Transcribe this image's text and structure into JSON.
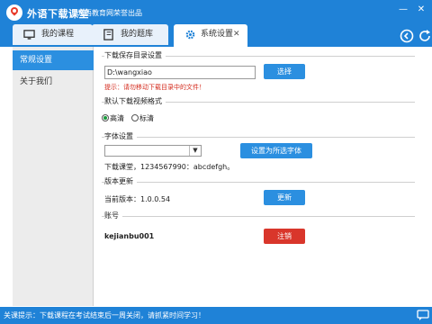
{
  "app": {
    "title": "外语下载课堂",
    "subtitle": "外语教育网荣誉出品",
    "minimize_glyph": "—",
    "close_glyph": "✕"
  },
  "tabs": [
    {
      "label": "我的课程",
      "icon": "monitor-icon"
    },
    {
      "label": "我的题库",
      "icon": "book-icon"
    },
    {
      "label": "系统设置",
      "icon": "gear-icon",
      "close_glyph": "✕",
      "active": true
    }
  ],
  "sidebar": {
    "items": [
      {
        "label": "常规设置",
        "selected": true
      },
      {
        "label": "关于我们",
        "selected": false
      }
    ]
  },
  "settings": {
    "download_path": {
      "title": "下载保存目录设置",
      "value": "D:\\wangxiao",
      "button": "选择",
      "hint": "提示：请勿移动下载目录中的文件！"
    },
    "video_format": {
      "title": "默认下载视频格式",
      "options": [
        {
          "label": "高清",
          "checked": true
        },
        {
          "label": "标清",
          "checked": false
        }
      ]
    },
    "font": {
      "title": "字体设置",
      "selected": "",
      "button": "设置为所选字体",
      "preview": "下载课堂，1234567990：abcdefgh。"
    },
    "version": {
      "title": "版本更新",
      "text": "当前版本：1.0.0.54",
      "button": "更新"
    },
    "account": {
      "title": "账号",
      "username": "kejianbu001",
      "button": "注销"
    }
  },
  "status": {
    "text": "关课提示：下载课程在考试结束后一周关闭，请抓紧时间学习！"
  },
  "colors": {
    "brand_blue": "#1f82d7",
    "accent_blue": "#2b8fe0",
    "danger_red": "#d9362b",
    "hint_red": "#d42a1c",
    "radio_green": "#1a9a3c"
  }
}
